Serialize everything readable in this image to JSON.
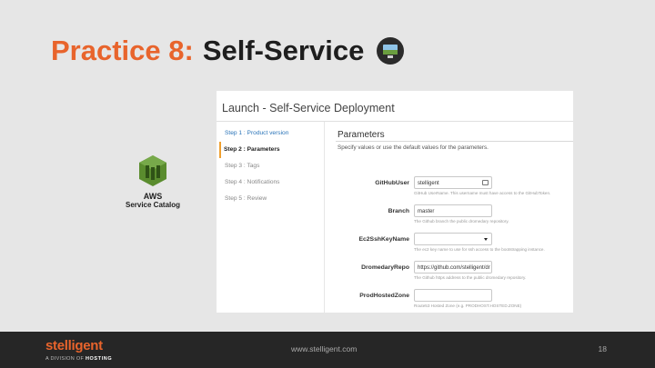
{
  "slide": {
    "title_accent": "Practice 8:",
    "title_main": "Self-Service",
    "title_icon": "monitor-icon"
  },
  "aws": {
    "icon": "aws-service-catalog-icon",
    "line1": "AWS",
    "line2": "Service Catalog",
    "color": "#5a8c2e"
  },
  "console": {
    "title": "Launch - Self-Service Deployment",
    "steps": [
      {
        "label": "Step 1 : Product version",
        "state": "link"
      },
      {
        "label": "Step 2 : Parameters",
        "state": "active"
      },
      {
        "label": "Step 3 : Tags",
        "state": "pending"
      },
      {
        "label": "Step 4 : Notifications",
        "state": "pending"
      },
      {
        "label": "Step 5 : Review",
        "state": "pending"
      }
    ],
    "parameters": {
      "heading": "Parameters",
      "description": "Specify values or use the default values for the parameters.",
      "fields": [
        {
          "label": "GitHubUser",
          "value": "stelligent",
          "help": "GitHub UserName. This username must have access to the GitHubToken.",
          "type": "text-with-icon"
        },
        {
          "label": "Branch",
          "value": "master",
          "help": "The Github branch the public dromedary repository.",
          "type": "text"
        },
        {
          "label": "Ec2SshKeyName",
          "value": "",
          "help": "The ec2 key name to use for ssh access to the bootstrapping instance.",
          "type": "select"
        },
        {
          "label": "DromedaryRepo",
          "value": "https://github.com/stelligent/dr",
          "help": "The Github https address to the public dromedary repository.",
          "type": "text"
        },
        {
          "label": "ProdHostedZone",
          "value": "",
          "help": "Route53 Hosted Zone (e.g. PRODHOST.HOSTED.ZONE)",
          "type": "text"
        }
      ]
    }
  },
  "footer": {
    "brand": "stelligent",
    "brand_sub_prefix": "A DIVISION OF",
    "brand_sub_name": "HOSTING",
    "url": "www.stelligent.com",
    "page": "18"
  },
  "colors": {
    "accent": "#e8642c",
    "background": "#e6e6e6",
    "footer": "#262626",
    "link": "#2a74b8",
    "active_marker": "#f0a030"
  }
}
